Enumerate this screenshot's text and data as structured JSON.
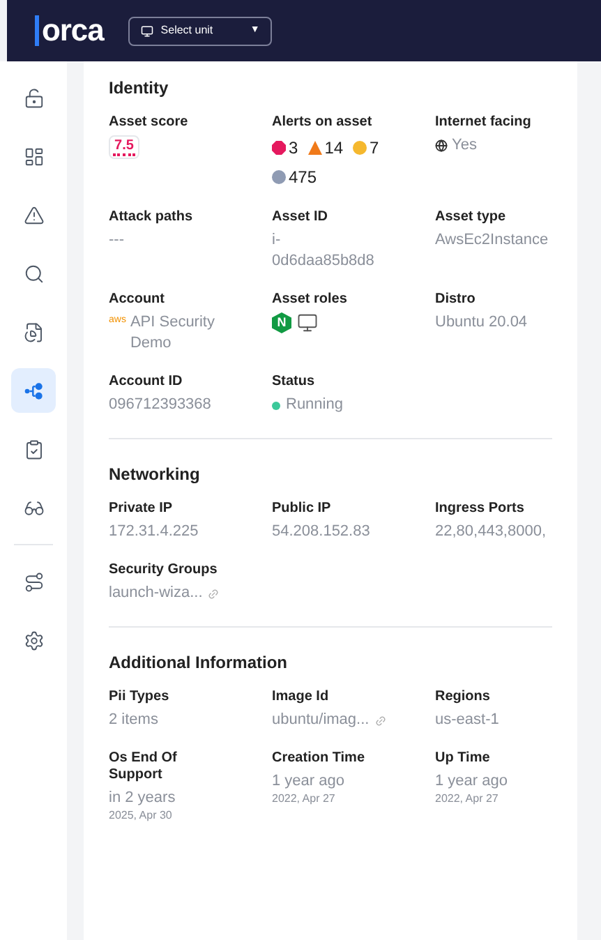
{
  "header": {
    "logo": "orca",
    "unit_select": "Select unit",
    "caret": "▼"
  },
  "sidebar": {
    "groups": [
      [
        {
          "selected": false
        },
        {
          "selected": false
        },
        {
          "selected": false
        },
        {
          "selected": false
        },
        {
          "selected": false
        },
        {
          "selected": true
        },
        {
          "selected": false
        },
        {
          "selected": false
        }
      ],
      [
        {
          "selected": false
        },
        {
          "selected": false
        }
      ]
    ]
  },
  "sections": [
    {
      "title": "Identity",
      "fields": [
        {
          "kind": "score",
          "label": "Asset score",
          "value": "7.5"
        },
        {
          "kind": "alerts",
          "label": "Alerts on asset",
          "alerts": [
            {
              "kind": "critical",
              "color": "#e5195e",
              "count": "3"
            },
            {
              "kind": "high",
              "color": "#f07a1a",
              "count": "14"
            },
            {
              "kind": "medium",
              "color": "#f5b82e",
              "count": "7"
            },
            {
              "kind": "info",
              "color": "#8f9bb3",
              "count": "475"
            }
          ]
        },
        {
          "kind": "globe",
          "label": "Internet facing",
          "value": "Yes"
        },
        {
          "kind": "text",
          "label": "Attack paths",
          "value": "---"
        },
        {
          "kind": "id",
          "label": "Asset ID",
          "value": "i-0d6daa85b8d8"
        },
        {
          "kind": "text",
          "label": "Asset type",
          "value": "AwsEc2Instance"
        },
        {
          "kind": "account",
          "label": "Account",
          "provider": "aws",
          "value": "API Security Demo"
        },
        {
          "kind": "roles",
          "label": "Asset roles",
          "roles": [
            {
              "kind": "nginx",
              "text": "N"
            },
            {
              "kind": "monitor"
            }
          ]
        },
        {
          "kind": "text",
          "label": "Distro",
          "value": "Ubuntu 20.04"
        },
        {
          "kind": "text",
          "label": "Account ID",
          "value": "096712393368"
        },
        {
          "kind": "status",
          "label": "Status",
          "value": "Running",
          "color": "#3cc99a"
        }
      ]
    },
    {
      "title": "Networking",
      "fields": [
        {
          "kind": "text",
          "label": "Private IP",
          "value": "172.31.4.225"
        },
        {
          "kind": "text",
          "label": "Public IP",
          "value": "54.208.152.83"
        },
        {
          "kind": "text",
          "label": "Ingress Ports",
          "value": "22,80,443,8000,"
        },
        {
          "kind": "link",
          "label": "Security Groups",
          "value": "launch-wiza..."
        }
      ]
    },
    {
      "title": "Additional Information",
      "fields": [
        {
          "kind": "text",
          "label": "Pii Types",
          "value": "2 items"
        },
        {
          "kind": "link",
          "label": "Image Id",
          "value": "ubuntu/imag..."
        },
        {
          "kind": "text",
          "label": "Regions",
          "value": "us-east-1"
        },
        {
          "kind": "time",
          "label": "Os End Of Support",
          "value": "in 2 years",
          "date": "2025, Apr 30"
        },
        {
          "kind": "time",
          "label": "Creation Time",
          "value": "1 year ago",
          "date": "2022, Apr 27"
        },
        {
          "kind": "time",
          "label": "Up Time",
          "value": "1 year ago",
          "date": "2022, Apr 27"
        }
      ]
    }
  ]
}
